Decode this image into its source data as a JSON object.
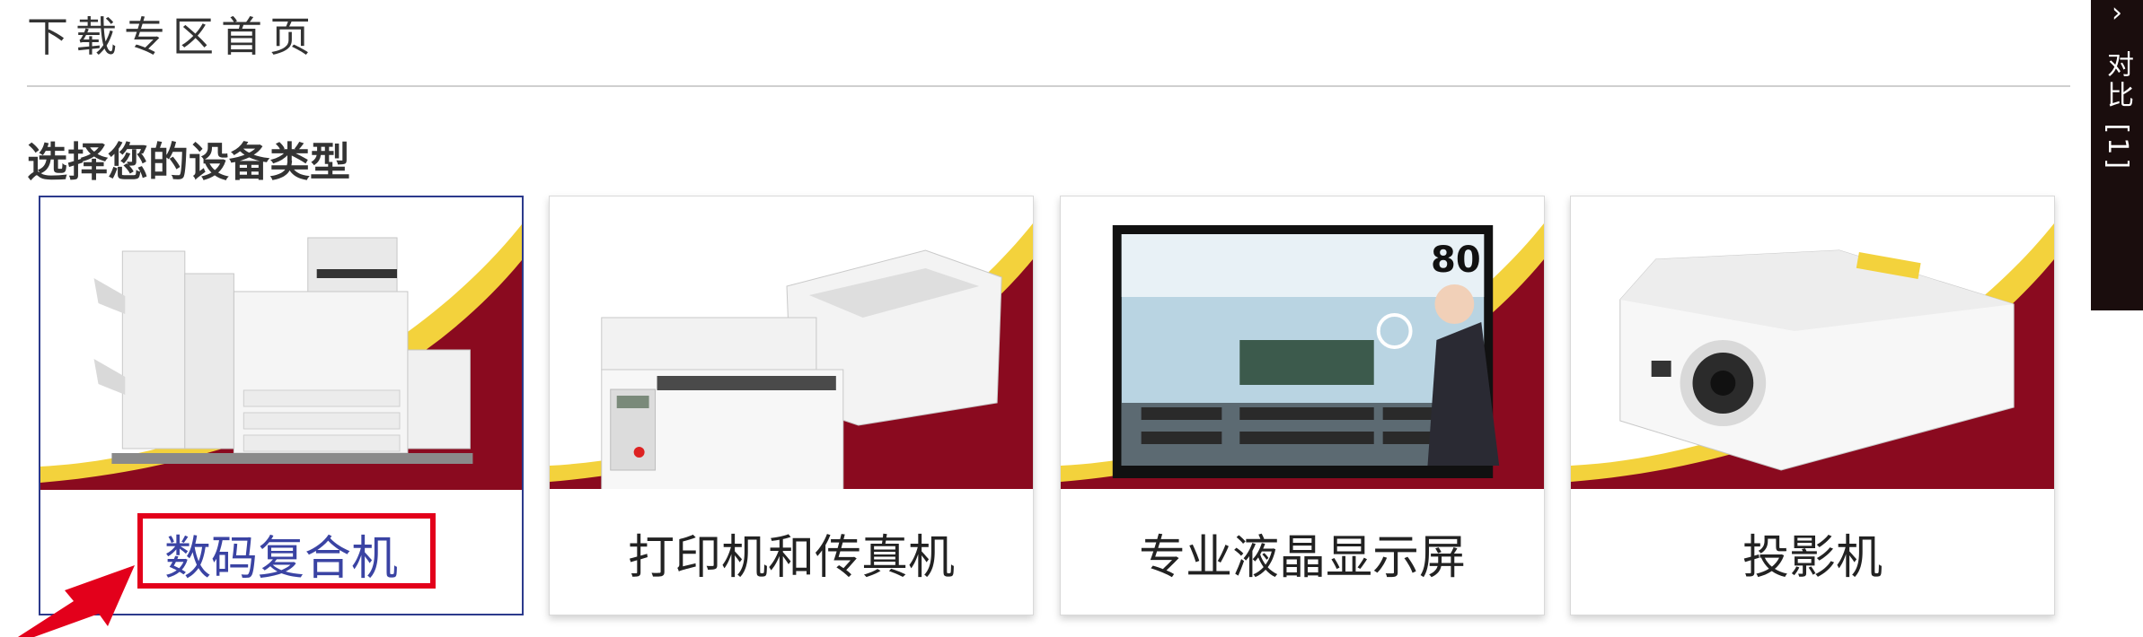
{
  "page": {
    "title": "下载专区首页",
    "section_heading": "选择您的设备类型"
  },
  "device_types": [
    {
      "label": "数码复合机",
      "selected": true
    },
    {
      "label": "打印机和传真机",
      "selected": false
    },
    {
      "label": "专业液晶显示屏",
      "selected": false
    },
    {
      "label": "投影机",
      "selected": false
    }
  ],
  "display_image": {
    "size_badge": "80"
  },
  "compare_tab": {
    "chevron": "›",
    "label": "对比 [1]"
  },
  "colors": {
    "banner_red": "#8a0a1f",
    "banner_yellow": "#f3d23c",
    "selected_border": "#2c3a8c",
    "selected_text": "#3a43a3",
    "highlight_red": "#e3001b",
    "compare_tab_bg": "#1a0d0d"
  }
}
